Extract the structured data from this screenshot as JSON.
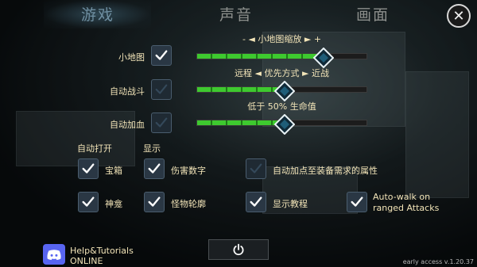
{
  "tabs": [
    {
      "label": "游戏",
      "active": true
    },
    {
      "label": "声音",
      "active": false
    },
    {
      "label": "画面",
      "active": false
    }
  ],
  "close_icon": "close-icon",
  "minimap": {
    "label": "小地图",
    "checked": true,
    "zoom_label": "- ◄ 小地图缩放 ► +",
    "slider_value": 0.74
  },
  "auto_battle": {
    "label": "自动战斗",
    "checked": true,
    "mode_label": "远程 ◄ 优先方式 ► 近战",
    "slider_value": 0.51
  },
  "auto_heal": {
    "label": "自动加血",
    "checked": true,
    "threshold_label": "低于 50% 生命值",
    "slider_value": 0.51
  },
  "section_headers": {
    "auto_open": "自动打开",
    "display": "显示"
  },
  "options": [
    {
      "id": "chest",
      "label": "宝箱",
      "checked": true
    },
    {
      "id": "damage",
      "label": "伤害数字",
      "checked": true
    },
    {
      "id": "autopoints",
      "label": "自动加点至装备需求的属性",
      "checked": true
    },
    {
      "id": "shrine",
      "label": "神龛",
      "checked": true
    },
    {
      "id": "outline",
      "label": "怪物轮廓",
      "checked": true
    },
    {
      "id": "tutorial",
      "label": "显示教程",
      "checked": true
    },
    {
      "id": "autowalk",
      "label": "Auto-walk on ranged Attacks",
      "checked": true
    }
  ],
  "discord": {
    "title": "Help&Tutorials",
    "status": "ONLINE"
  },
  "power_icon": "power-icon",
  "version": "early access v.1.20.37",
  "colors": {
    "slider_fill": "#3ec92f",
    "accent_text": "#f2e4b8",
    "checkbox_bg": "#2a3744"
  }
}
